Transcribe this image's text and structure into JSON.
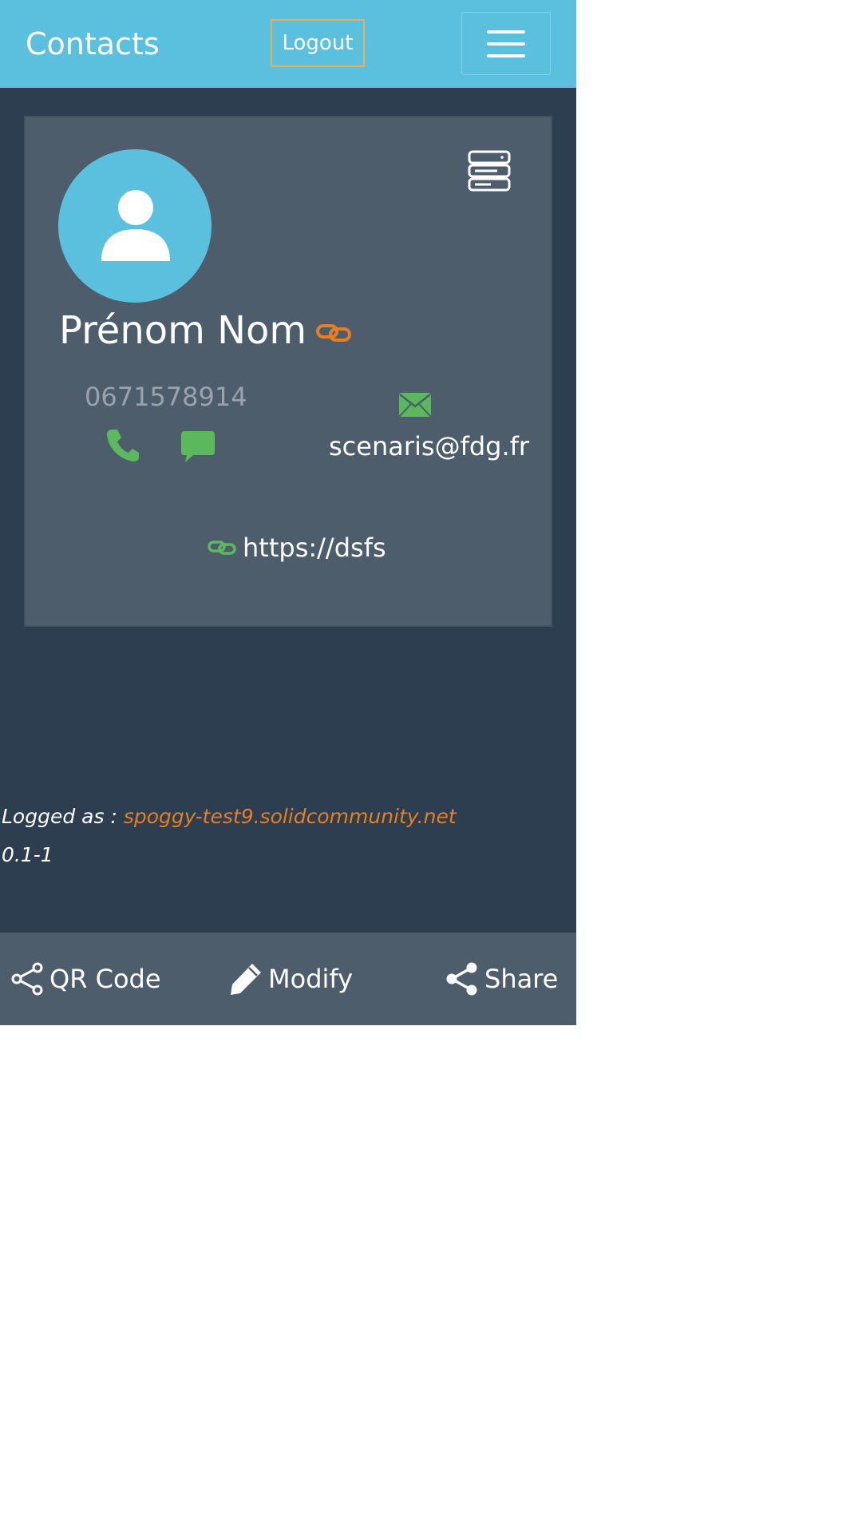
{
  "navbar": {
    "brand": "Contacts",
    "logout_label": "Logout"
  },
  "contact": {
    "name": "Prénom Nom",
    "phone": "0671578914",
    "email": "scenaris@fdg.fr",
    "website": "https://dsfs"
  },
  "footer": {
    "logged_prefix": "Logged as : ",
    "account": "spoggy-test9.solidcommunity.net",
    "version": "0.1-1"
  },
  "actions": {
    "qr_label": "QR Code",
    "modify_label": "Modify",
    "share_label": "Share"
  },
  "icons": {
    "menu": "hamburger-icon",
    "server": "server-icon",
    "avatar": "user-icon",
    "link": "link-icon",
    "phone": "phone-icon",
    "sms": "chat-icon",
    "mail": "envelope-icon",
    "qr": "share-nodes-icon",
    "modify": "pencil-icon",
    "share": "share-nodes-icon"
  },
  "colors": {
    "navbar": "#5bc0de",
    "background": "#2c3e50",
    "card": "#4e5d6c",
    "accent_orange": "#e67e22",
    "accent_green": "#5cb85c",
    "logout_border": "#f0ad4e"
  }
}
